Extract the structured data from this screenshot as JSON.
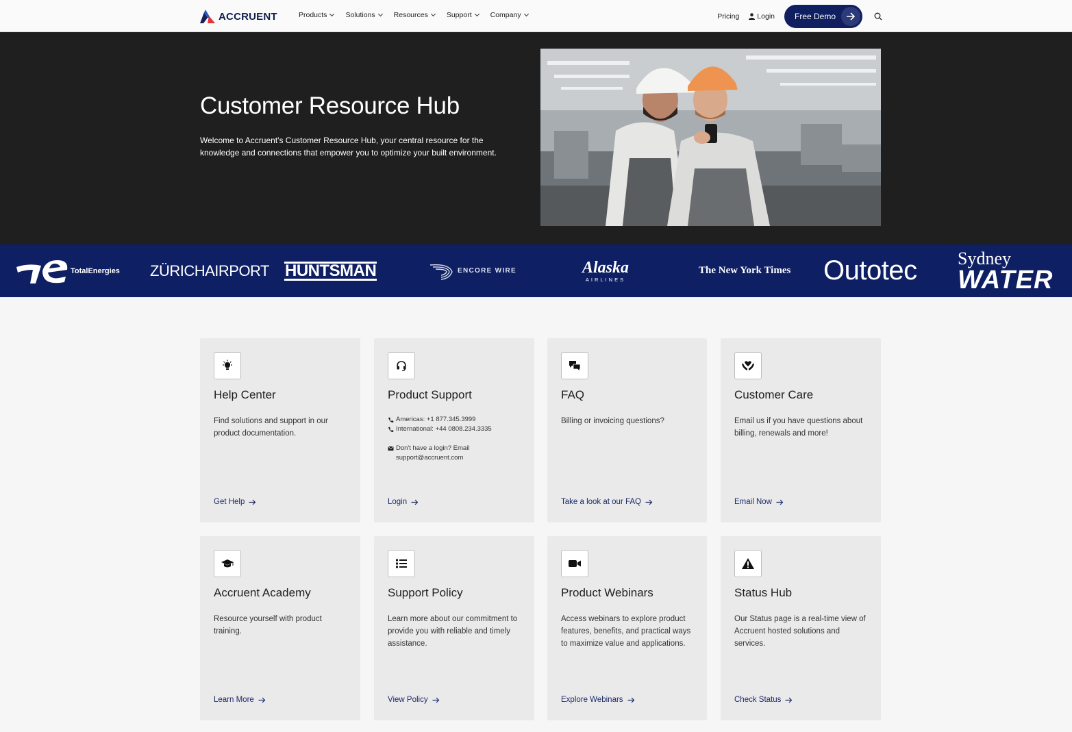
{
  "nav": {
    "logo_text": "ACCRUENT",
    "menu": [
      "Products",
      "Solutions",
      "Resources",
      "Support",
      "Company"
    ],
    "pricing": "Pricing",
    "login": "Login",
    "cta": "Free Demo"
  },
  "hero": {
    "title": "Customer Resource Hub",
    "description": "Welcome to Accruent's Customer Resource Hub, your central resource for the knowledge and connections that empower you to optimize your built environment."
  },
  "brands": [
    "TotalEnergies",
    "ZÜRICHAIRPORT",
    "HUNTSMAN",
    "ENCORE WIRE",
    "Alaska",
    "AIRLINES",
    "The New York Times",
    "Outotec",
    "Sydney",
    "WATER"
  ],
  "cards": [
    {
      "icon": "lightbulb-icon",
      "title": "Help Center",
      "description": "Find solutions and support in our product documentation.",
      "link": "Get Help"
    },
    {
      "icon": "headset-icon",
      "title": "Product Support",
      "americas": "Americas: +1 877.345.3999",
      "international": "International: +44 0808.234.3335",
      "login_note": "Don't have a login? Email support@accruent.com",
      "link": "Login"
    },
    {
      "icon": "chat-icon",
      "title": "FAQ",
      "description": "Billing or invoicing questions?",
      "link": "Take a look at our FAQ"
    },
    {
      "icon": "care-hands-icon",
      "title": "Customer Care",
      "description": "Email us if you have questions about billing, renewals and more!",
      "link": "Email Now"
    },
    {
      "icon": "graduation-cap-icon",
      "title": "Accruent Academy",
      "description": "Resource yourself with product training.",
      "link": "Learn More"
    },
    {
      "icon": "list-icon",
      "title": "Support Policy",
      "description": "Learn more about our commitment to provide you with reliable and timely assistance.",
      "link": "View Policy"
    },
    {
      "icon": "video-camera-icon",
      "title": "Product Webinars",
      "description": "Access webinars to explore product features, benefits, and practical ways to maximize value and applications.",
      "link": "Explore Webinars"
    },
    {
      "icon": "warning-icon",
      "title": "Status Hub",
      "description": "Our Status page is a real-time view of Accruent hosted solutions and services.",
      "link": "Check Status"
    }
  ]
}
